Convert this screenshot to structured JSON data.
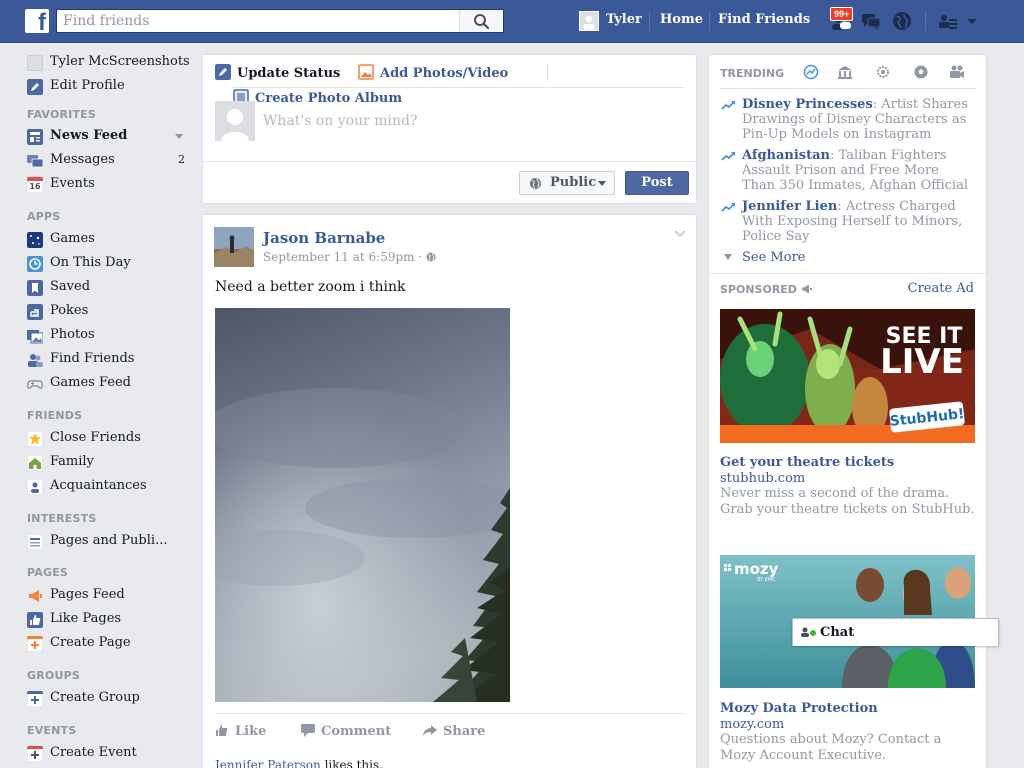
{
  "colors": {
    "brand": "#3b5998",
    "page_bg": "#e9eaed",
    "muted": "#9197a3",
    "notif": "#f03d25",
    "post_button": "#4e69a2"
  },
  "topbar": {
    "search_placeholder": "Find friends",
    "user": "Tyler",
    "home": "Home",
    "find_friends": "Find Friends",
    "notification_count": "99+",
    "icons": [
      "facebook-logo-icon",
      "search-icon",
      "friend-requests-icon",
      "messages-icon",
      "globe-notifications-icon",
      "privacy-shortcuts-icon",
      "settings-caret-icon"
    ]
  },
  "leftnav": {
    "profile_name": "Tyler McScreenshots",
    "edit_profile": "Edit Profile",
    "favorites_head": "FAVORITES",
    "news_feed": "News Feed",
    "messages": "Messages",
    "messages_count": "2",
    "events": "Events",
    "calendar_day": "16",
    "apps_head": "APPS",
    "games": "Games",
    "on_this_day": "On This Day",
    "saved": "Saved",
    "pokes": "Pokes",
    "photos": "Photos",
    "find_friends": "Find Friends",
    "games_feed": "Games Feed",
    "friends_head": "FRIENDS",
    "close_friends": "Close Friends",
    "family": "Family",
    "acquaintances": "Acquaintances",
    "interests_head": "INTERESTS",
    "pages_and_publi": "Pages and Publi...",
    "pages_head": "PAGES",
    "pages_feed": "Pages Feed",
    "like_pages": "Like Pages",
    "create_page": "Create Page",
    "groups_head": "GROUPS",
    "create_group": "Create Group",
    "events_head": "EVENTS",
    "create_event": "Create Event"
  },
  "composer": {
    "update_status": "Update Status",
    "add_photos": "Add Photos/Video",
    "create_album": "Create Photo Album",
    "placeholder": "What's on your mind?",
    "audience": "Public",
    "post": "Post"
  },
  "post": {
    "author": "Jason Barnabe",
    "time": "September 11 at 6:59pm · ",
    "text": "Need a better zoom i think",
    "like": "Like",
    "comment": "Comment",
    "share": "Share",
    "liker": "Jennifer Paterson",
    "likes_suffix": " likes this."
  },
  "trending": {
    "head": "TRENDING",
    "items": [
      {
        "topic": "Disney Princesses",
        "desc": ": Artist Shares Drawings of Disney Characters as Pin-Up Models on Instagram"
      },
      {
        "topic": "Afghanistan",
        "desc": ": Taliban Fighters Assault Prison and Free More Than 350 Inmates, Afghan Official"
      },
      {
        "topic": "Jennifer Lien",
        "desc": ": Actress Charged With Exposing Herself to Minors, Police Say"
      }
    ],
    "see_more": "See More"
  },
  "sponsored": {
    "head": "SPONSORED",
    "create_ad": "Create Ad",
    "ads": [
      {
        "art_line1": "SEE IT",
        "art_line2": "LIVE",
        "art_brand": "StubHub!",
        "title": "Get your theatre tickets",
        "domain": "stubhub.com",
        "body": "Never miss a second of the drama. Grab your theatre tickets on StubHub."
      },
      {
        "art_brand": "mozy",
        "art_sub": "BY EMC",
        "title": "Mozy Data Protection",
        "domain": "mozy.com",
        "body": "Questions about Mozy? Contact a Mozy Account Executive."
      }
    ]
  },
  "chat": {
    "label": "Chat"
  }
}
